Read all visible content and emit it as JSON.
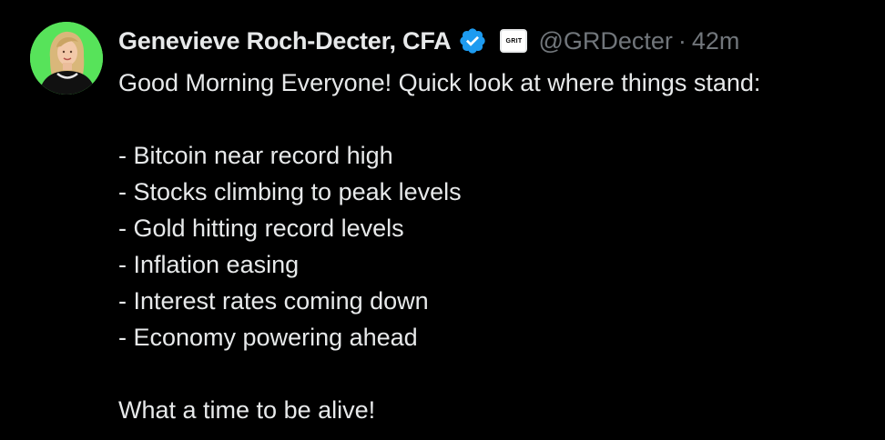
{
  "post": {
    "author": {
      "display_name": "Genevieve Roch-Decter, CFA",
      "verified_icon": "verified-badge-icon",
      "affiliate_badge_text": "GRIT",
      "handle": "@GRDecter",
      "separator": "·",
      "timestamp": "42m",
      "avatar_background": "#57e35a"
    },
    "intro": "Good Morning Everyone! Quick look at where things stand:",
    "items": [
      "- Bitcoin near record high",
      "- Stocks climbing to peak levels",
      "- Gold hitting record levels",
      "- Inflation easing",
      "- Interest rates coming down",
      "- Economy powering ahead"
    ],
    "closing": "What a time to be alive!"
  },
  "colors": {
    "background": "#000000",
    "text_primary": "#e7e9ea",
    "text_secondary": "#71767b",
    "verified_blue": "#1d9bf0"
  }
}
